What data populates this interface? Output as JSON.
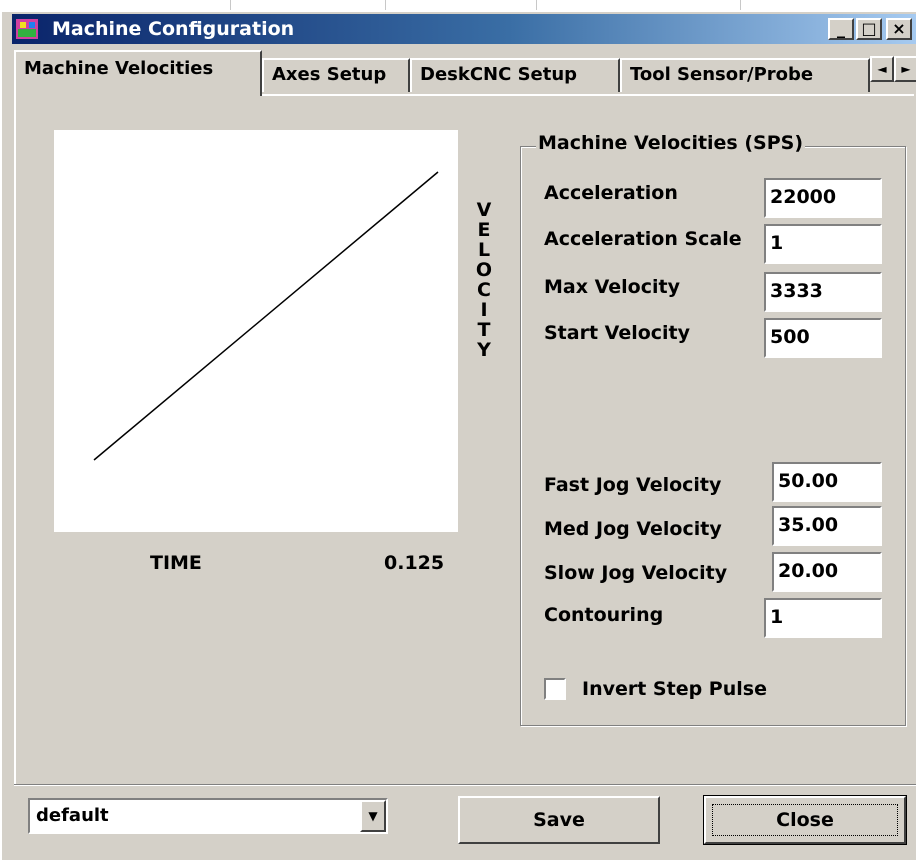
{
  "window": {
    "title": "Machine Configuration"
  },
  "titlebar_buttons": {
    "minimize": "_",
    "maximize": "□",
    "close": "×"
  },
  "tabs": [
    {
      "label": "Machine Velocities",
      "active": true
    },
    {
      "label": "Axes Setup",
      "active": false
    },
    {
      "label": "DeskCNC Setup",
      "active": false
    },
    {
      "label": "Tool Sensor/Probe",
      "active": false
    }
  ],
  "tab_scroll": {
    "left": "◄",
    "right": "►"
  },
  "graph": {
    "time_label": "TIME",
    "time_value": "0.125",
    "velocity_label": "VELOCITY"
  },
  "group": {
    "title": "Machine Velocities (SPS)",
    "fields": [
      {
        "label": "Acceleration",
        "value": "22000"
      },
      {
        "label": "Acceleration Scale",
        "value": "1"
      },
      {
        "label": "Max Velocity",
        "value": "3333"
      },
      {
        "label": "Start Velocity",
        "value": "500"
      },
      {
        "label": "Fast Jog Velocity",
        "value": "50.00"
      },
      {
        "label": "Med Jog Velocity",
        "value": "35.00"
      },
      {
        "label": "Slow Jog Velocity",
        "value": "20.00"
      },
      {
        "label": "Contouring",
        "value": "1"
      }
    ],
    "checkbox": {
      "label": "Invert Step Pulse",
      "checked": false
    }
  },
  "footer": {
    "profile_selected": "default",
    "save_label": "Save",
    "close_label": "Close"
  },
  "colors": {
    "titlebar_start": "#0a246a",
    "titlebar_end": "#a6caf0",
    "window_bg": "#d4d0c8"
  }
}
